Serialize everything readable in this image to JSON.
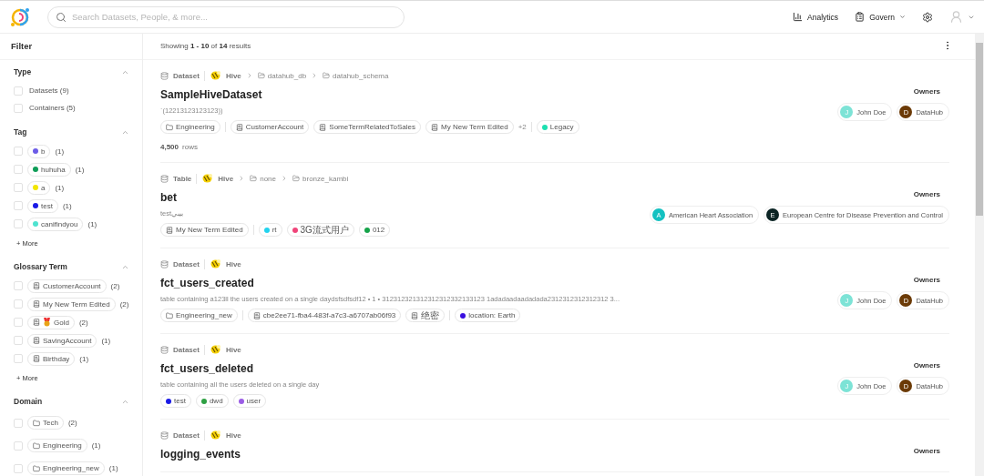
{
  "header": {
    "search": {
      "placeholder": "Search Datasets, People, & more..."
    },
    "nav": [
      {
        "kind": "analytics",
        "label": "Analytics"
      },
      {
        "kind": "govern",
        "label": "Govern"
      }
    ]
  },
  "sidebar": {
    "title": "Filter",
    "sections": [
      {
        "kind": "plain",
        "title": "Type",
        "expanded": true,
        "items": [
          {
            "label": "Datasets (9)",
            "checked": false
          },
          {
            "label": "Containers (5)",
            "checked": false
          }
        ]
      },
      {
        "kind": "tag",
        "title": "Tag",
        "expanded": true,
        "more": "+ More",
        "items": [
          {
            "label": "b",
            "count": "(1)",
            "color": "#6c5ce7",
            "checked": false
          },
          {
            "label": "huhuha",
            "count": "(1)",
            "color": "#0f9d58",
            "checked": false
          },
          {
            "label": "a",
            "count": "(1)",
            "color": "#f2e600",
            "checked": false
          },
          {
            "label": "test",
            "count": "(1)",
            "color": "#1a1ae6",
            "checked": false
          },
          {
            "label": "canifindyou",
            "count": "(1)",
            "color": "#4fe3d0",
            "checked": false
          }
        ]
      },
      {
        "kind": "term",
        "title": "Glossary Term",
        "expanded": true,
        "more": "+ More",
        "items": [
          {
            "label": "CustomerAccount",
            "count": "(2)",
            "checked": false
          },
          {
            "label": "My New Term Edited",
            "count": "(2)",
            "checked": false
          },
          {
            "label": "Gold",
            "count": "(2)",
            "medal": true,
            "checked": false
          },
          {
            "label": "SavingAccount",
            "count": "(1)",
            "checked": false
          },
          {
            "label": "Birthday",
            "count": "(1)",
            "checked": false
          }
        ]
      },
      {
        "kind": "domain",
        "title": "Domain",
        "expanded": true,
        "items": [
          {
            "label": "Tech",
            "count": "(2)",
            "checked": false
          },
          {
            "label": "Engineering",
            "count": "(1)",
            "checked": false
          },
          {
            "label": "Engineering_new",
            "count": "(1)",
            "checked": false
          }
        ]
      }
    ]
  },
  "results": {
    "summary": "Showing **1 - 10** of **14** results",
    "items": [
      {
        "type": "Dataset",
        "platform": "Hive",
        "path": [
          "datahub_db",
          "datahub_schema"
        ],
        "title": "SampleHiveDataset",
        "description": "`(12213123123123))",
        "groups": [
          {
            "kind": "domain",
            "items": [
              {
                "label": "Engineering"
              }
            ]
          },
          {
            "kind": "term",
            "items": [
              {
                "label": "CustomerAccount"
              },
              {
                "label": "SomeTermRelatedToSales"
              },
              {
                "label": "My New Term Edited"
              }
            ],
            "more": "+2"
          },
          {
            "kind": "tag",
            "items": [
              {
                "label": "Legacy",
                "color": "#1ce0b0"
              }
            ]
          }
        ],
        "stats": {
          "value": "4,500",
          "unit": "rows"
        },
        "owners_label": "Owners",
        "owners": [
          {
            "initial": "J",
            "name": "John Doe",
            "color": "#7de3d6"
          },
          {
            "initial": "D",
            "name": "DataHub",
            "color": "#6b3a06"
          }
        ]
      },
      {
        "type": "Table",
        "platform": "Hive",
        "path": [
          "none",
          "bronze_kambi"
        ],
        "title": "bet",
        "description": "testبيبي",
        "groups": [
          {
            "kind": "term",
            "items": [
              {
                "label": "My New Term Edited"
              }
            ]
          },
          {
            "kind": "tag",
            "items": [
              {
                "label": "rt",
                "color": "#22d3ee"
              },
              {
                "label": "3G流式用户",
                "color": "#f0457a"
              },
              {
                "label": "012",
                "color": "#16a34a"
              }
            ]
          }
        ],
        "owners_label": "Owners",
        "owners": [
          {
            "initial": "A",
            "name": "American Heart Association",
            "color": "#14c1c1"
          },
          {
            "initial": "E",
            "name": "European Centre for Disease Prevention and Control",
            "color": "#0b2424"
          }
        ]
      },
      {
        "type": "Dataset",
        "platform": "Hive",
        "title": "fct_users_created",
        "description": "table containing a123ll the users created on a single daydsfsdfsdf12 • 1 • 312312321312312312332133123 1adadaadaadadada2312312312312312 3...",
        "groups": [
          {
            "kind": "domain",
            "items": [
              {
                "label": "Engineering_new"
              }
            ]
          },
          {
            "kind": "term",
            "items": [
              {
                "label": "cbe2ee71-fba4-483f-a7c3-a6707ab06f93"
              },
              {
                "label": "绝密"
              }
            ]
          },
          {
            "kind": "tag",
            "items": [
              {
                "label": "location: Earth",
                "color": "#3b10e0"
              }
            ]
          }
        ],
        "owners_label": "Owners",
        "owners": [
          {
            "initial": "J",
            "name": "John Doe",
            "color": "#7de3d6"
          },
          {
            "initial": "D",
            "name": "DataHub",
            "color": "#6b3a06"
          }
        ]
      },
      {
        "type": "Dataset",
        "platform": "Hive",
        "title": "fct_users_deleted",
        "description": "table containing all the users deleted on a single day",
        "groups": [
          {
            "kind": "tag",
            "items": [
              {
                "label": "test",
                "color": "#1a1ae6"
              },
              {
                "label": "dwd",
                "color": "#2ea043"
              },
              {
                "label": "user",
                "color": "#9b5de5"
              }
            ]
          }
        ],
        "owners_label": "Owners",
        "owners": [
          {
            "initial": "J",
            "name": "John Doe",
            "color": "#7de3d6"
          },
          {
            "initial": "D",
            "name": "DataHub",
            "color": "#6b3a06"
          }
        ]
      },
      {
        "type": "Dataset",
        "platform": "Hive",
        "title": "logging_events",
        "owners_label": "Owners"
      }
    ]
  }
}
